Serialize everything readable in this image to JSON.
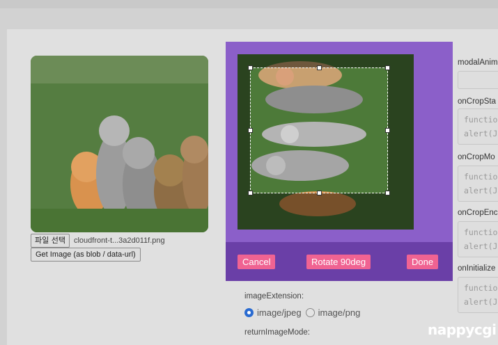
{
  "left": {
    "file_button": "파일 선택",
    "file_name": "cloudfront-t...3a2d011f.png",
    "get_image_button": "Get Image (as blob / data-url)"
  },
  "sidebar": {
    "items": [
      {
        "label": "modalAnim",
        "code": ""
      },
      {
        "label": "onCropSta",
        "code": "function\nalert(JS("
      },
      {
        "label": "onCropMo",
        "code": "function\nalert(JS("
      },
      {
        "label": "onCropEnc",
        "code": "function\nalert(JS("
      },
      {
        "label": "onInitialize",
        "code": "function\nalert(JS("
      }
    ]
  },
  "middle": {
    "options_label_partial": "..."
  },
  "image_extension": {
    "label": "imageExtension:",
    "options": [
      "image/jpeg",
      "image/png"
    ],
    "selected": "image/jpeg"
  },
  "return_mode_label": "returnImageMode:",
  "modal": {
    "cancel": "Cancel",
    "rotate": "Rotate 90deg",
    "done": "Done"
  },
  "watermark": "nappycgi",
  "colors": {
    "modal_bg": "#8b5fc9",
    "modal_footer": "#6a3fa7",
    "button_pink": "#f06392",
    "radio_selected": "#2a6bd1"
  }
}
